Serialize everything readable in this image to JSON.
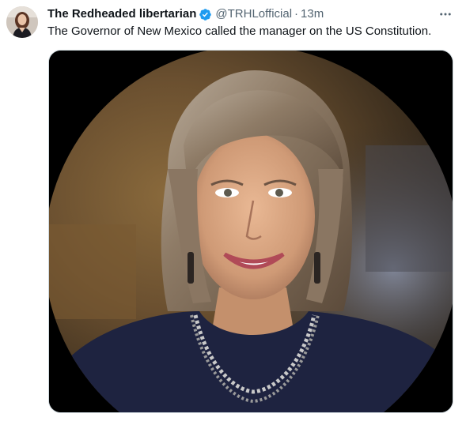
{
  "tweet": {
    "author": {
      "display_name": "The Redheaded libertarian",
      "handle": "@TRHLofficial",
      "verified": true,
      "verified_color": "#1d9bf0",
      "avatar_icon": "profile-photo"
    },
    "separator": "·",
    "timestamp": "13m",
    "more_icon": "more-horizontal-icon",
    "text": "The Governor of New Mexico called the manager on the US Constitution.",
    "media": {
      "type": "photo",
      "shape": "circular crop on black background"
    }
  }
}
